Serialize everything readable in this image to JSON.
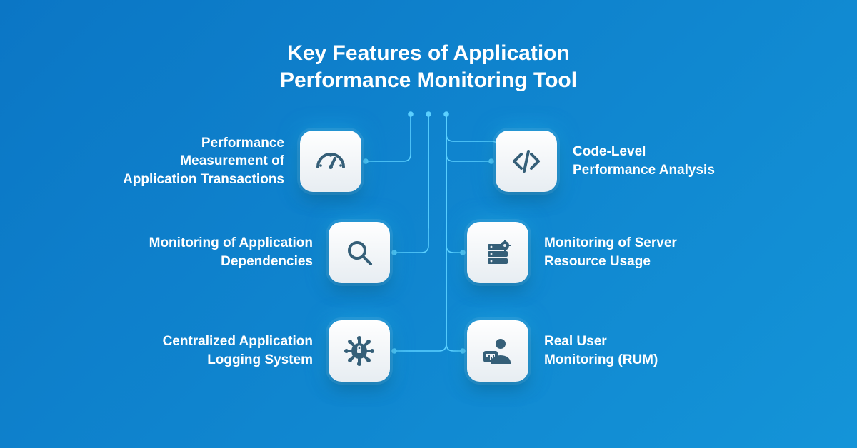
{
  "title": "Key Features of Application\nPerformance Monitoring Tool",
  "left": [
    {
      "label": "Performance\nMeasurement of\nApplication Transactions"
    },
    {
      "label": "Monitoring of Application\nDependencies"
    },
    {
      "label": "Centralized Application\nLogging System"
    }
  ],
  "right": [
    {
      "label": "Code-Level\nPerformance Analysis"
    },
    {
      "label": "Monitoring of Server\nResource Usage"
    },
    {
      "label": "Real User\nMonitoring (RUM)"
    }
  ],
  "colors": {
    "bg_start": "#0b76c5",
    "bg_end": "#1494d8",
    "icon": "#355f78",
    "connector": "#5bd0ff"
  }
}
